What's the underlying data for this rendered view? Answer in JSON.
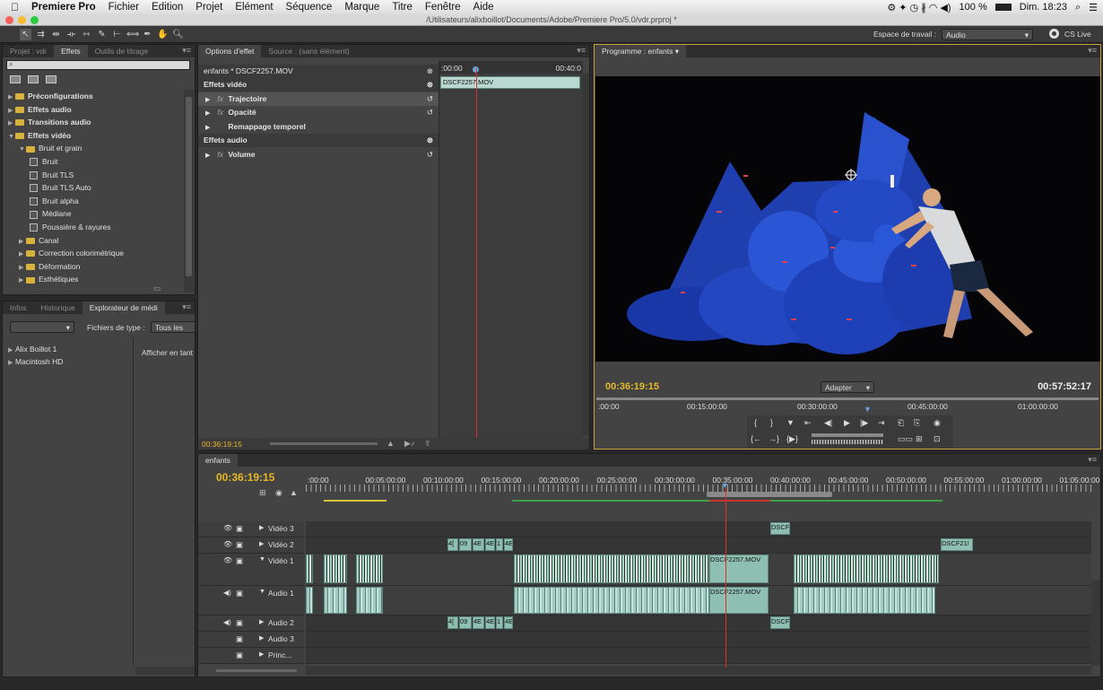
{
  "menubar": {
    "app": "Premiere Pro",
    "items": [
      "Fichier",
      "Edition",
      "Projet",
      "Elément",
      "Séquence",
      "Marque",
      "Titre",
      "Fenêtre",
      "Aide"
    ],
    "battery": "100 %",
    "clock": "Dim. 18:23"
  },
  "titlebar": {
    "path": "/Utilisateurs/alixboillot/Documents/Adobe/Premiere Pro/5.0/vdr.prproj *"
  },
  "toolbar": {
    "workspace_label": "Espace de travail :",
    "workspace_value": "Audio",
    "cslive": "CS Live"
  },
  "left_panel": {
    "tabs": [
      "Projet : vdr",
      "Effets",
      "Outils de titrage"
    ],
    "tree": [
      {
        "label": "Préconfigurations",
        "level": 0,
        "bold": true,
        "type": "folder"
      },
      {
        "label": "Effets audio",
        "level": 0,
        "bold": true,
        "type": "folder"
      },
      {
        "label": "Transitions audio",
        "level": 0,
        "bold": true,
        "type": "folder"
      },
      {
        "label": "Effets vidéo",
        "level": 0,
        "bold": true,
        "type": "folder",
        "open": true
      },
      {
        "label": "Bruit et grain",
        "level": 1,
        "bold": false,
        "type": "folder",
        "open": true
      },
      {
        "label": "Bruit",
        "level": 2,
        "type": "fx"
      },
      {
        "label": "Bruit TLS",
        "level": 2,
        "type": "fx"
      },
      {
        "label": "Bruit TLS Auto",
        "level": 2,
        "type": "fx"
      },
      {
        "label": "Bruit alpha",
        "level": 2,
        "type": "fx"
      },
      {
        "label": "Médiane",
        "level": 2,
        "type": "fx"
      },
      {
        "label": "Poussière & rayures",
        "level": 2,
        "type": "fx"
      },
      {
        "label": "Canal",
        "level": 1,
        "type": "folder"
      },
      {
        "label": "Correction colorimétrique",
        "level": 1,
        "type": "folder"
      },
      {
        "label": "Déformation",
        "level": 1,
        "type": "folder"
      },
      {
        "label": "Esthétiques",
        "level": 1,
        "type": "folder"
      }
    ]
  },
  "media_panel": {
    "tabs": [
      "Infos",
      "Historique",
      "Explorateur de médi"
    ],
    "filetype_label": "Fichiers de type :",
    "filetype_value": "Tous les fich",
    "drives": [
      "Alix Boillot 1",
      "Macintosh HD"
    ],
    "display_label": "Afficher en tant"
  },
  "effect_controls": {
    "tabs": [
      "Options d'effet",
      "Source : (sans élément)"
    ],
    "clip_title": "enfants * DSCF2257.MOV",
    "ruler_start": ":00:00",
    "ruler_end": "00:40:0",
    "clip_bar": "DSCF2257.MOV",
    "rows": [
      {
        "label": "Effets vidéo",
        "head": true
      },
      {
        "label": "Trajectoire",
        "fx": true
      },
      {
        "label": "Opacité",
        "fx": true
      },
      {
        "label": "Remappage temporel",
        "fx": false
      },
      {
        "label": "Effets audio",
        "head": true
      },
      {
        "label": "Volume",
        "fx": true
      }
    ],
    "timecode": "00:36:19:15"
  },
  "program": {
    "tab": "Programme : enfants",
    "timecode": "00:36:19:15",
    "fit": "Adapter",
    "duration": "00:57:52:17",
    "ruler": [
      ":00:00",
      "00:15:00:00",
      "00:30:00:00",
      "00:45:00:00",
      "01:00:00:00"
    ]
  },
  "timeline": {
    "tab": "enfants",
    "timecode": "00:36:19:15",
    "ruler": [
      ":00:00",
      "00:05:00:00",
      "00:10:00:00",
      "00:15:00:00",
      "00:20:00:00",
      "00:25:00:00",
      "00:30:00:00",
      "00:35:00:00",
      "00:40:00:00",
      "00:45:00:00",
      "00:50:00:00",
      "00:55:00:00",
      "01:00:00:00",
      "01:05:00:00"
    ],
    "tracks": [
      "Vidéo 3",
      "Vidéo 2",
      "Vidéo 1",
      "Audio 1",
      "Audio 2",
      "Audio 3",
      "Princ..."
    ],
    "clips": {
      "v3": "DSCF",
      "v2_a": "4[",
      "v2_b": "09",
      "v2_c": "4E",
      "v2_d": "4E",
      "v2_e": "1",
      "v2_f": "4E",
      "v2_end": "DSCF21!",
      "v1_main": "DSCF2257.MOV",
      "a1_main": "DSCF2257.MOV",
      "a2_end": "DSCF"
    }
  },
  "colors": {
    "accent": "#e8b926",
    "playhead": "#d93030",
    "clip": "#8fbfb3"
  }
}
